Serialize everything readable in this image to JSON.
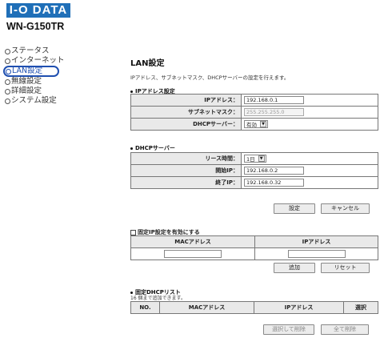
{
  "brand": {
    "logo": "I-O DATA",
    "model": "WN-G150TR",
    "logo_color": "#1f6fb8"
  },
  "nav": {
    "items": [
      {
        "label": "ステータス"
      },
      {
        "label": "インターネット"
      },
      {
        "label": "LAN設定"
      },
      {
        "label": "無線設定"
      },
      {
        "label": "詳細設定"
      },
      {
        "label": "システム設定"
      }
    ],
    "active_index": 2,
    "active_color": "#1f4fb0"
  },
  "page": {
    "title": "LAN設定",
    "description": "IPアドレス、サブネットマスク、DHCPサーバーの設定を行えます。"
  },
  "ip_section": {
    "title": "IPアドレス設定",
    "ip_label": "IPアドレス：",
    "ip_value": "192.168.0.1",
    "subnet_label": "サブネットマスク：",
    "subnet_value": "255.255.255.0",
    "dhcp_label": "DHCPサーバー：",
    "dhcp_value": "有効"
  },
  "dhcp_section": {
    "title": "DHCPサーバー",
    "lease_label": "リース時間：",
    "lease_value": "1日",
    "start_label": "開始IP：",
    "start_value": "192.168.0.2",
    "end_label": "終了IP：",
    "end_value": "192.168.0.32"
  },
  "buttons": {
    "set": "設定",
    "cancel": "キャンセル",
    "add": "追加",
    "reset": "リセット",
    "delete_selected": "選択して削除",
    "delete_all": "全て削除"
  },
  "static_ip": {
    "checkbox_label": "固定IP設定を有効にする",
    "checked": false,
    "col_mac": "MACアドレス",
    "col_ip": "IPアドレス",
    "mac_value": "",
    "ip_value": ""
  },
  "dhcp_list": {
    "title": "固定DHCPリスト",
    "note": "16 個まで追加できます。",
    "col_no": "NO.",
    "col_mac": "MACアドレス",
    "col_ip": "IPアドレス",
    "col_select": "選択"
  }
}
